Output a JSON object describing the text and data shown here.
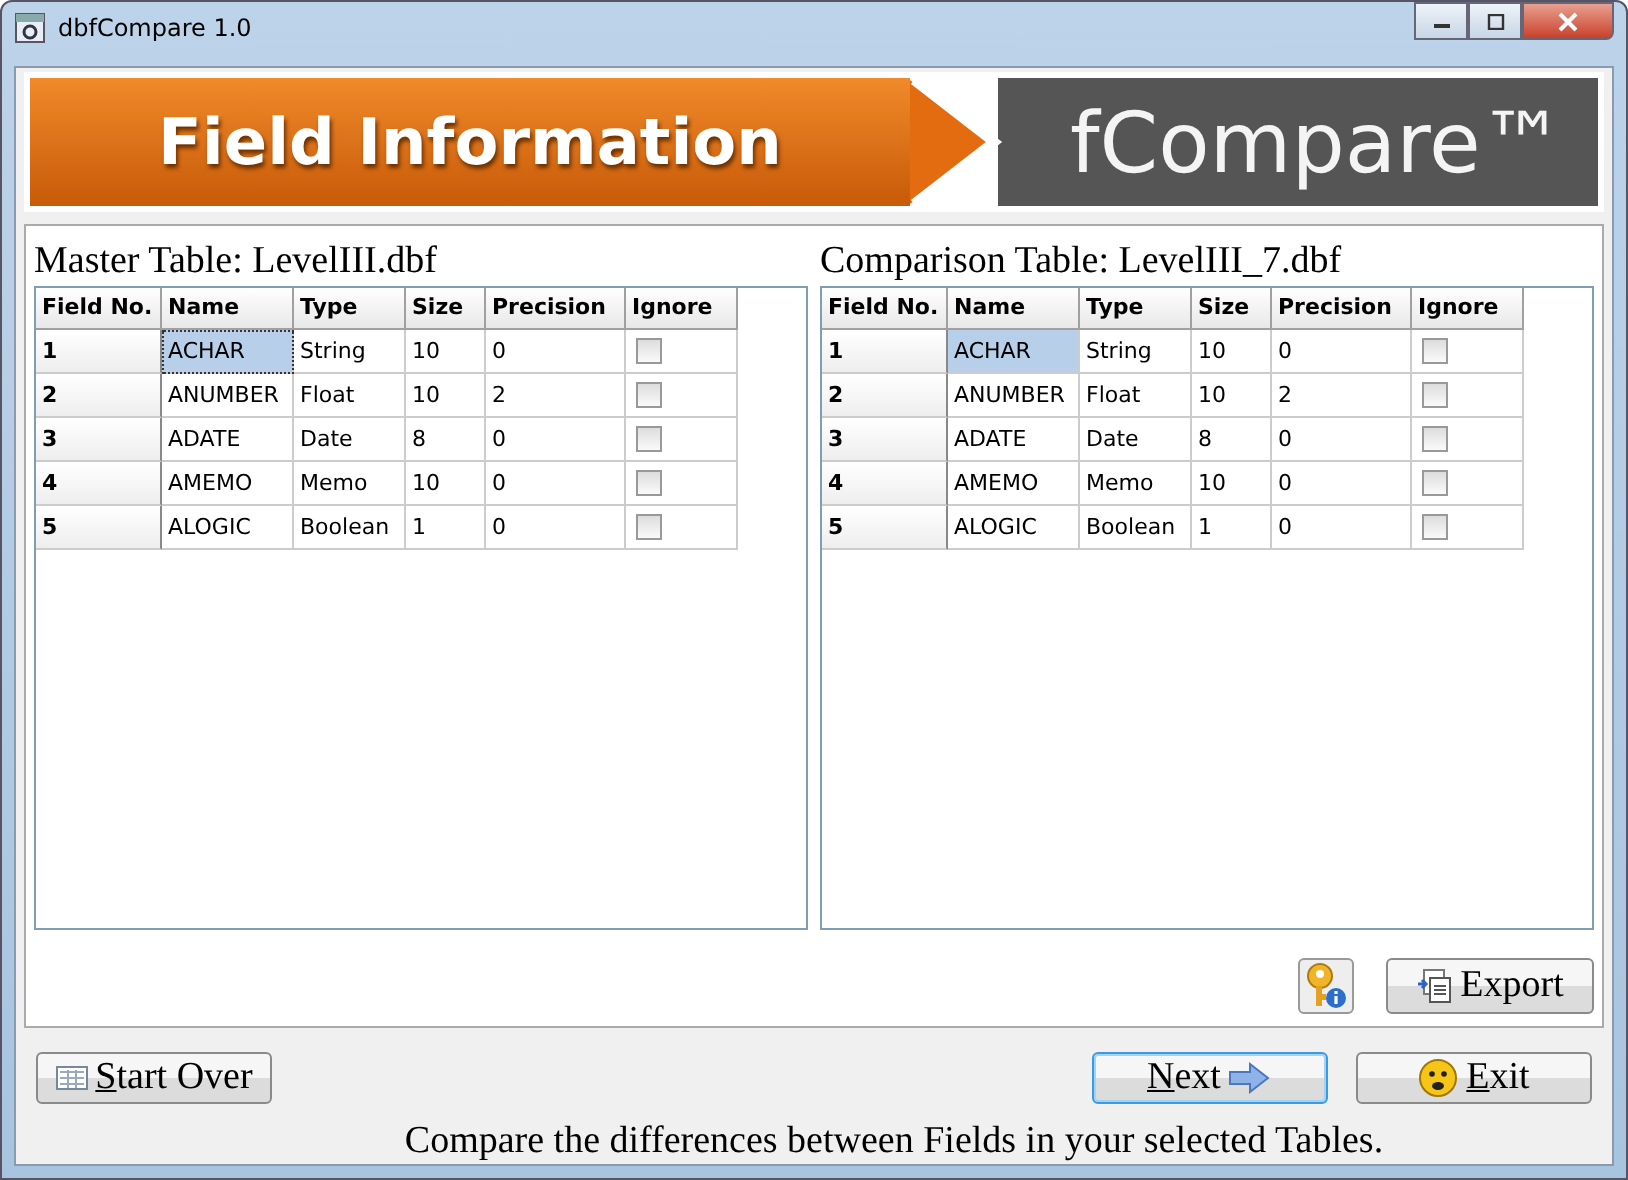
{
  "window": {
    "title": "dbfCompare 1.0"
  },
  "banner": {
    "title": "Field Information",
    "brand": "fCompare™"
  },
  "tables": [
    {
      "caption": "Master Table: LevelIII.dbf",
      "focused": true,
      "columns": [
        "Field No.",
        "Name",
        "Type",
        "Size",
        "Precision",
        "Ignore"
      ],
      "rows": [
        {
          "no": "1",
          "name": "ACHAR",
          "type": "String",
          "size": "10",
          "precision": "0",
          "ignore": false,
          "selected": true
        },
        {
          "no": "2",
          "name": "ANUMBER",
          "type": "Float",
          "size": "10",
          "precision": "2",
          "ignore": false,
          "selected": false
        },
        {
          "no": "3",
          "name": "ADATE",
          "type": "Date",
          "size": "8",
          "precision": "0",
          "ignore": false,
          "selected": false
        },
        {
          "no": "4",
          "name": "AMEMO",
          "type": "Memo",
          "size": "10",
          "precision": "0",
          "ignore": false,
          "selected": false
        },
        {
          "no": "5",
          "name": "ALOGIC",
          "type": "Boolean",
          "size": "1",
          "precision": "0",
          "ignore": false,
          "selected": false
        }
      ]
    },
    {
      "caption": "Comparison Table: LevelIII_7.dbf",
      "focused": false,
      "columns": [
        "Field No.",
        "Name",
        "Type",
        "Size",
        "Precision",
        "Ignore"
      ],
      "rows": [
        {
          "no": "1",
          "name": "ACHAR",
          "type": "String",
          "size": "10",
          "precision": "0",
          "ignore": false,
          "selected": true
        },
        {
          "no": "2",
          "name": "ANUMBER",
          "type": "Float",
          "size": "10",
          "precision": "2",
          "ignore": false,
          "selected": false
        },
        {
          "no": "3",
          "name": "ADATE",
          "type": "Date",
          "size": "8",
          "precision": "0",
          "ignore": false,
          "selected": false
        },
        {
          "no": "4",
          "name": "AMEMO",
          "type": "Memo",
          "size": "10",
          "precision": "0",
          "ignore": false,
          "selected": false
        },
        {
          "no": "5",
          "name": "ALOGIC",
          "type": "Boolean",
          "size": "1",
          "precision": "0",
          "ignore": false,
          "selected": false
        }
      ]
    }
  ],
  "export_button": {
    "label": "Export"
  },
  "nav": [
    {
      "kind": "start",
      "accel": "S",
      "rest": "tart Over",
      "focused": false
    },
    {
      "kind": "next",
      "accel": "N",
      "rest": "ext",
      "focused": true
    },
    {
      "kind": "exit",
      "accel": "E",
      "rest": "xit",
      "focused": false
    }
  ],
  "status": "Compare the differences between Fields in your selected Tables."
}
